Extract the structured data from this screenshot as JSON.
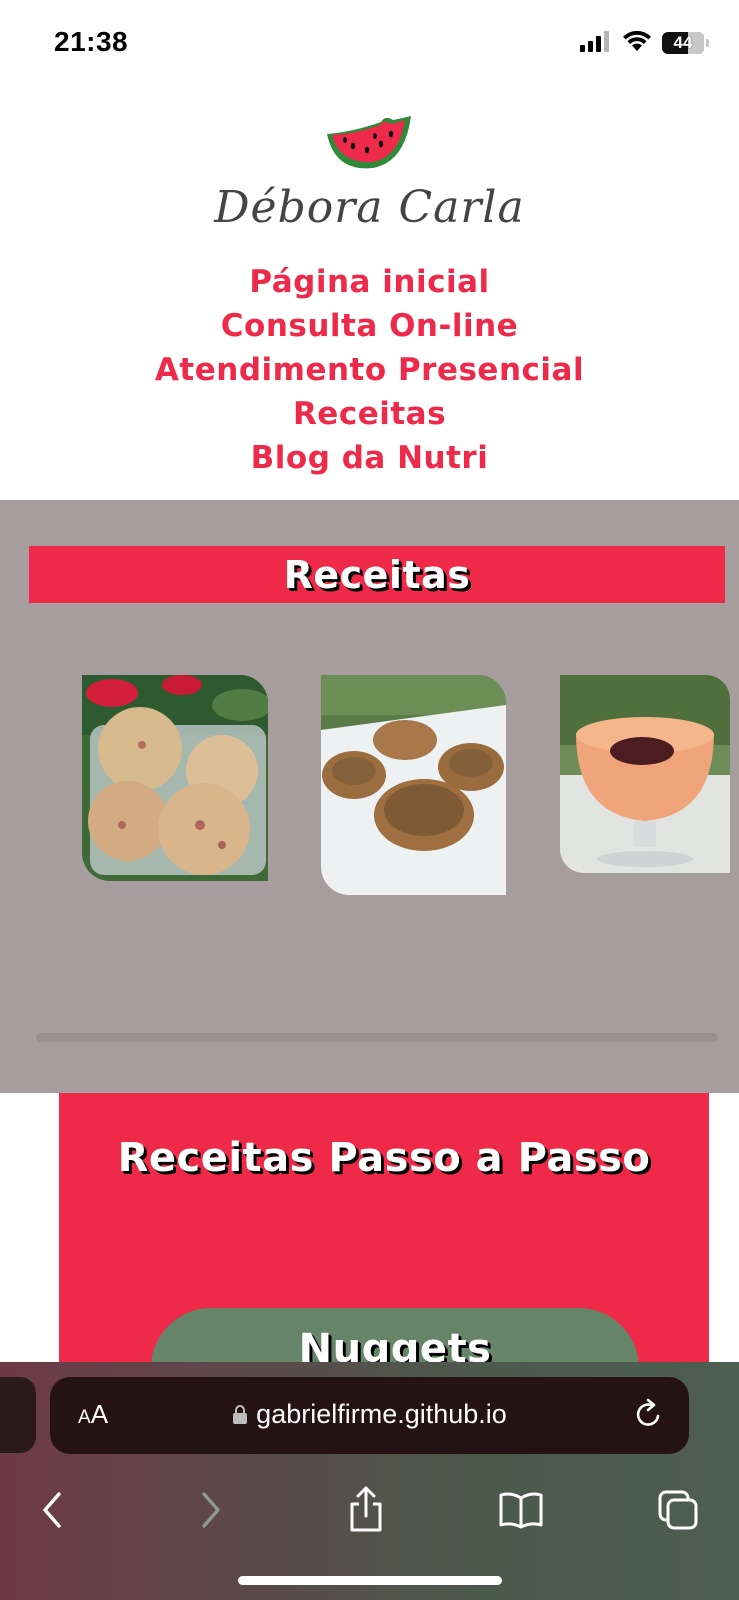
{
  "status_bar": {
    "time": "21:38",
    "battery_level": "44",
    "icons": [
      "cellular-signal-icon",
      "wifi-icon",
      "battery-icon"
    ]
  },
  "header": {
    "logo_text": "Débora Carla",
    "logo_icon": "watermelon-slice-icon"
  },
  "nav": {
    "items": [
      {
        "label": "Página inicial"
      },
      {
        "label": "Consulta On-line"
      },
      {
        "label": "Atendimento Presencial"
      },
      {
        "label": "Receitas"
      },
      {
        "label": "Blog da Nutri"
      }
    ]
  },
  "recipes_section": {
    "title": "Receitas",
    "cards": [
      {
        "image": "nuggets-photo"
      },
      {
        "image": "muffins-photo"
      },
      {
        "image": "mousse-photo"
      }
    ]
  },
  "steps_section": {
    "title": "Receitas Passo a Passo",
    "button_label": "Nuggets"
  },
  "browser": {
    "aa_label_small": "A",
    "aa_label_large": "A",
    "url": "gabrielfirme.github.io"
  },
  "colors": {
    "brand_red": "#ef2a48",
    "section_grey": "#a89d9e",
    "button_green": "#668467"
  }
}
